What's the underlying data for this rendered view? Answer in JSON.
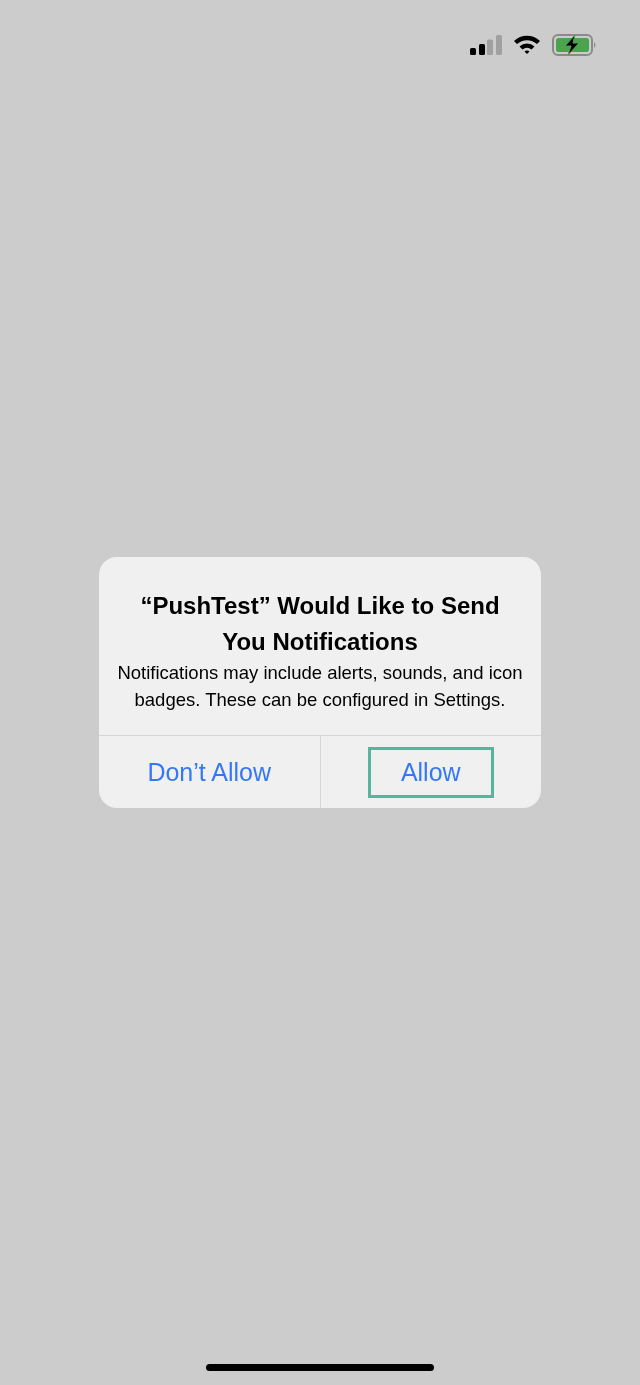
{
  "alert": {
    "title": "“PushTest” Would Like to Send You Notifications",
    "message": "Notifications may include alerts, sounds, and icon badges. These can be configured in Settings.",
    "buttons": [
      {
        "label": "Don’t Allow",
        "selected": false
      },
      {
        "label": "Allow",
        "selected": true
      }
    ]
  }
}
